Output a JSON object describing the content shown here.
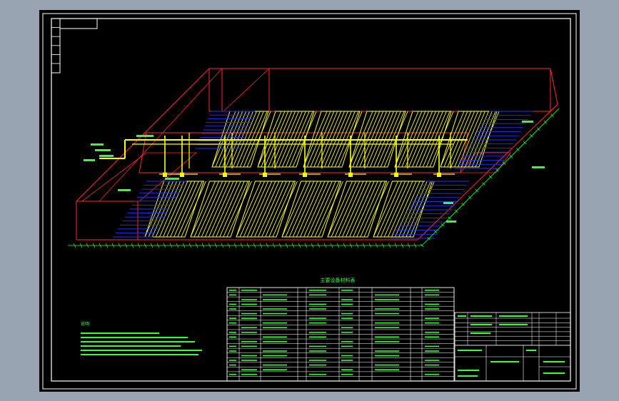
{
  "colors": {
    "frame": "#ffffff",
    "tank": "#ff2a2a",
    "hatch": "#ffff33",
    "pipe": "#ffff00",
    "panel_blue": "#2233ff",
    "annotation": "#33ff33",
    "table_line": "#ffffff",
    "table_text": "#33ff33"
  },
  "drawing": {
    "title": "",
    "table_title": "主要设备材料表",
    "notes_header": "说明"
  }
}
